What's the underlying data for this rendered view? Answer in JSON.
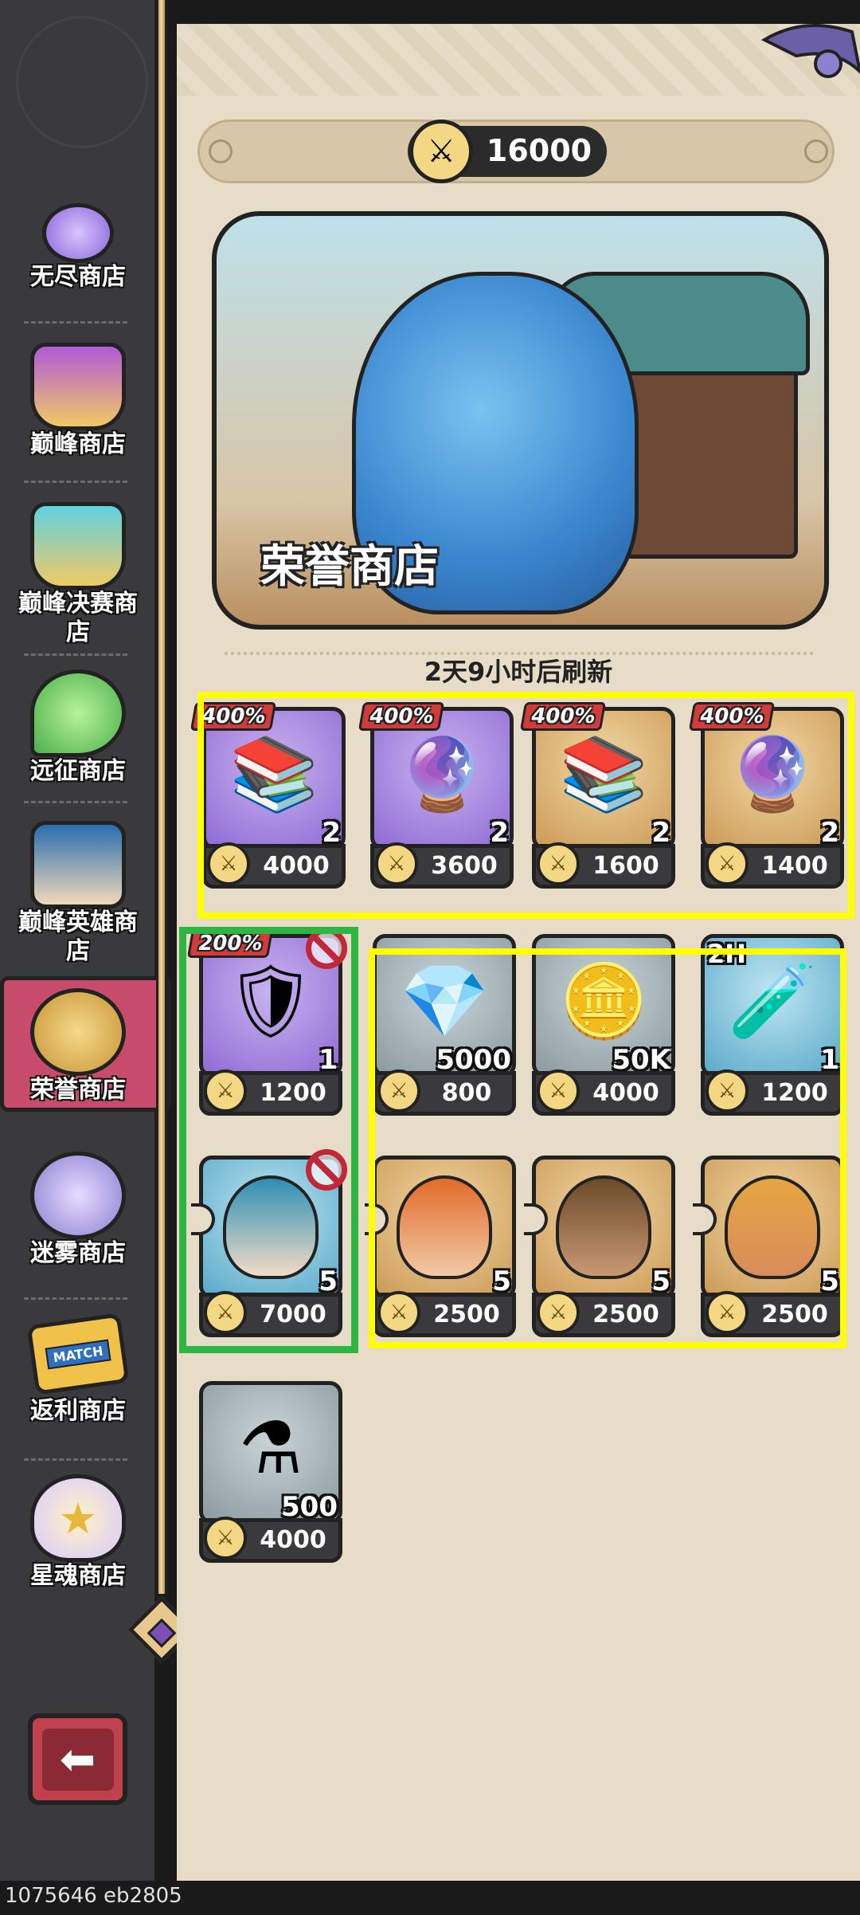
{
  "currency": {
    "amount": "16000"
  },
  "banner": {
    "title": "荣誉商店"
  },
  "refresh": {
    "text": "2天9小时后刷新"
  },
  "sidebar": {
    "items": [
      {
        "label": "无尽商店",
        "icon": "slime-icon"
      },
      {
        "label": "巅峰商店",
        "icon": "crown-icon"
      },
      {
        "label": "巅峰决赛商店",
        "icon": "crown-shield-icon"
      },
      {
        "label": "远征商店",
        "icon": "green-slime-icon"
      },
      {
        "label": "巅峰英雄商店",
        "icon": "hero-portrait-icon"
      },
      {
        "label": "荣誉商店",
        "icon": "crossed-swords-icon",
        "active": true
      },
      {
        "label": "迷雾商店",
        "icon": "mist-orb-icon"
      },
      {
        "label": "返利商店",
        "icon": "match-ticket-icon",
        "badge": "MATCH"
      },
      {
        "label": "星魂商店",
        "icon": "star-soul-icon"
      }
    ]
  },
  "shop": {
    "row1": [
      {
        "discount": "400%",
        "qty": "2",
        "price": "4000",
        "item": "skill-book-icon",
        "bg": "purple"
      },
      {
        "discount": "400%",
        "qty": "2",
        "price": "3600",
        "item": "gear-orb-icon",
        "bg": "purple"
      },
      {
        "discount": "400%",
        "qty": "2",
        "price": "1600",
        "item": "skill-book-icon",
        "bg": "gold"
      },
      {
        "discount": "400%",
        "qty": "2",
        "price": "1400",
        "item": "gear-orb-icon",
        "bg": "gold"
      }
    ],
    "row2": [
      {
        "discount": "200%",
        "qty": "1",
        "price": "1200",
        "item": "armor-chest-icon",
        "bg": "purple",
        "banned": true
      },
      {
        "qty": "5000",
        "price": "800",
        "item": "crystal-icon",
        "bg": "grey"
      },
      {
        "qty": "50K",
        "price": "4000",
        "item": "gold-coin-icon",
        "bg": "grey"
      },
      {
        "timer": "2H",
        "qty": "1",
        "price": "1200",
        "item": "potion-ticket-icon",
        "bg": "blue"
      }
    ],
    "row3": [
      {
        "qty": "5",
        "price": "7000",
        "item": "hero-shard-blue-icon",
        "bg": "blue",
        "banned": true
      },
      {
        "qty": "5",
        "price": "2500",
        "item": "hero-shard-redhair-icon",
        "bg": "gold"
      },
      {
        "qty": "5",
        "price": "2500",
        "item": "hero-shard-dreadlocks-icon",
        "bg": "gold"
      },
      {
        "qty": "5",
        "price": "2500",
        "item": "hero-shard-beard-icon",
        "bg": "gold"
      }
    ],
    "row4": [
      {
        "qty": "500",
        "price": "4000",
        "item": "purple-potion-icon",
        "bg": "grey"
      }
    ]
  },
  "watermark": "1075646 eb2805"
}
